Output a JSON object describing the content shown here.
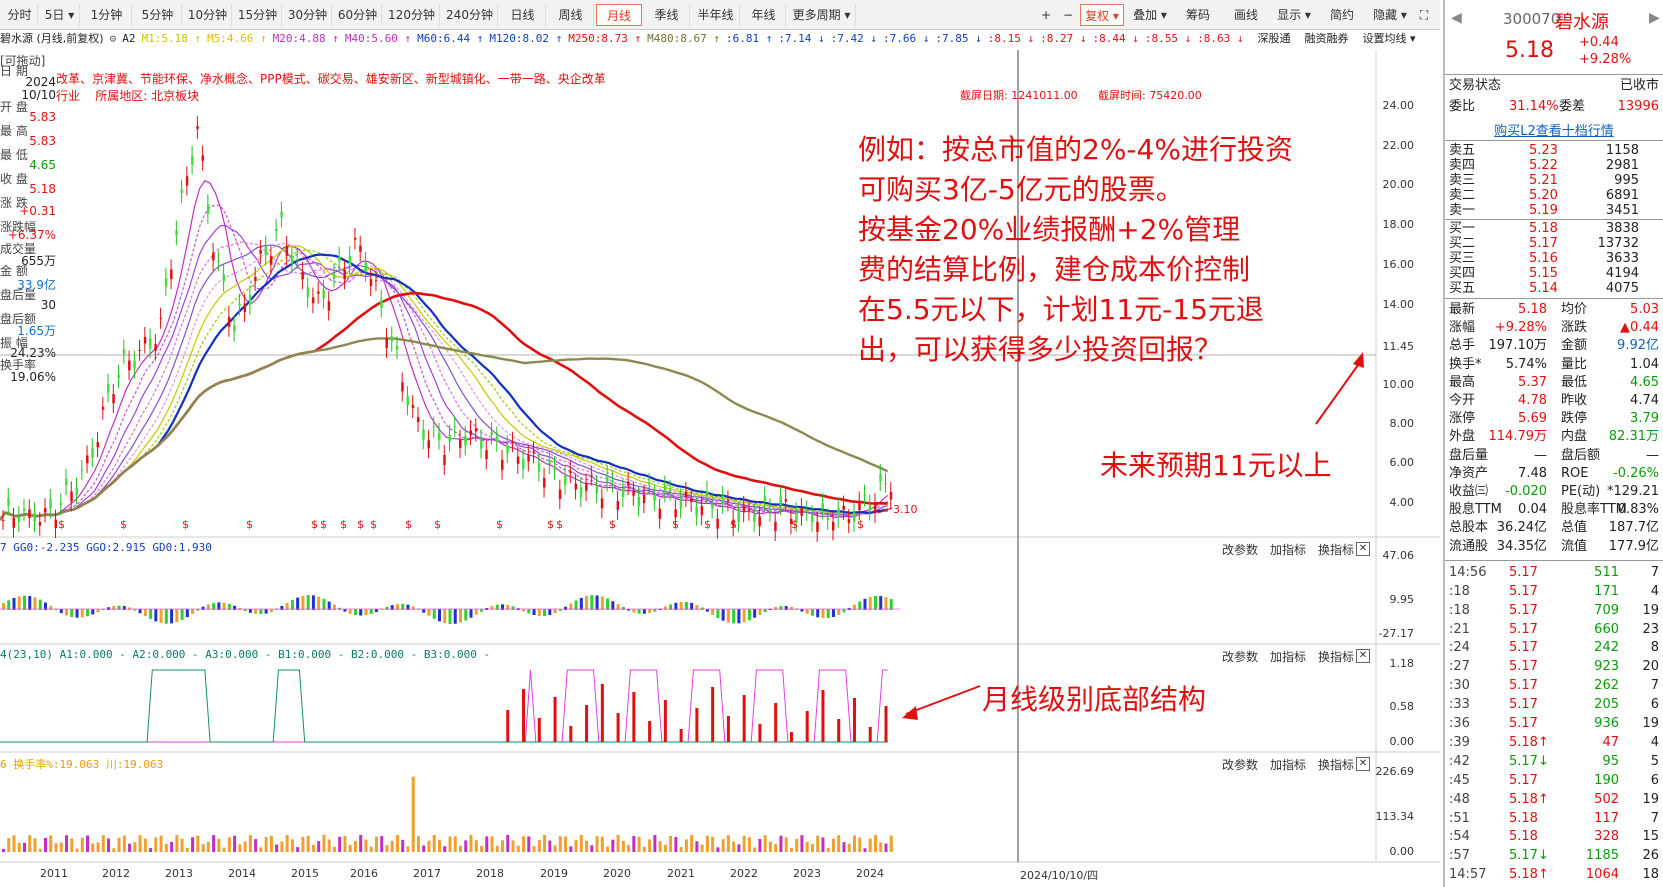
{
  "toolbar": {
    "periods": [
      "分时",
      "5日",
      "1分钟",
      "5分钟",
      "10分钟",
      "15分钟",
      "30分钟",
      "60分钟",
      "120分钟",
      "240分钟",
      "日线",
      "周线",
      "月线",
      "季线",
      "半年线",
      "年线",
      "更多周期"
    ],
    "active": "月线",
    "right_btns": [
      "+",
      "−",
      "复权",
      "叠加",
      "筹码",
      "画线",
      "显示",
      "简约",
      "隐藏"
    ]
  },
  "chart_header": {
    "stock_label": "碧水源 (月线,前复权)",
    "flags": "A2",
    "ma": [
      "M1:5.18",
      "M5:4.66",
      "M20:4.88",
      "M40:5.60",
      "M60:6.44",
      "M120:8.02",
      "M250:8.73",
      "M480:8.67",
      ":6.81",
      ":7.14",
      ":7.42",
      ":7.66",
      ":7.85",
      ":8.15",
      ":8.27",
      ":8.44",
      ":8.55",
      ":8.63"
    ],
    "links": [
      "深股通",
      "融资融券",
      "设置均线"
    ]
  },
  "concepts": "改革、京津冀、节能环保、净水概念、PPP模式、碳交易、雄安新区、新型城镇化、一带一路、央企改革",
  "industry": "行业",
  "region": "所属地区: 北京板块",
  "screenshot_date": "截屏日期: 1241011.00",
  "screenshot_time": "截屏时间: 75420.00",
  "left_info": {
    "drag": "[可拖动]",
    "labels": [
      "日 期",
      "开 盘",
      "最 高",
      "最 低",
      "收 盘",
      "涨 跌",
      "涨跌幅",
      "成交量",
      "金 额",
      "盘后量",
      "盘后额",
      "振 幅",
      "换手率"
    ],
    "values": [
      "2024",
      "10/10",
      "5.83",
      "5.83",
      "4.65",
      "5.18",
      "+0.31",
      "+6.37%",
      "655万",
      "33.9亿",
      "30",
      "1.65万",
      "24.23%",
      "19.06%"
    ]
  },
  "price_axis": [
    "24.00",
    "22.00",
    "20.00",
    "18.00",
    "16.00",
    "14.00",
    "11.45",
    "10.00",
    "8.00",
    "6.00",
    "4.00"
  ],
  "low_mark": "3.10",
  "x_axis": [
    "2011",
    "2012",
    "2013",
    "2014",
    "2015",
    "2016",
    "2017",
    "2018",
    "2019",
    "2020",
    "2021",
    "2022",
    "2023",
    "2024"
  ],
  "cursor_date": "2024/10/10/四",
  "panel1": {
    "label": "7  GG0:-2.235  GGO:2.915  GD0:1.930",
    "axis": [
      "47.06",
      "9.95",
      "-27.17"
    ]
  },
  "panel2": {
    "label": "4(23,10)  A1:0.000 - A2:0.000 - A3:0.000 - B1:0.000 - B2:0.000 - B3:0.000 -",
    "axis": [
      "1.18",
      "0.58",
      "0.00"
    ]
  },
  "panel3": {
    "label": "6  换手率%:19.063  川:19.063",
    "axis": [
      "226.69",
      "113.34",
      "0.00"
    ]
  },
  "panel_btns": [
    "改参数",
    "加指标",
    "换指标"
  ],
  "annotation_main": [
    "例如：按总市值的2%-4%进行投资",
    "可购买3亿-5亿元的股票。",
    "按基金20%业绩报酬+2%管理",
    "费的结算比例，建仓成本价控制",
    "在5.5元以下，计划11元-15元退",
    "出，可以获得多少投资回报？"
  ],
  "annotation_future": "未来预期11元以上",
  "annotation_bottom": "月线级别底部结构",
  "quote": {
    "code": "300070",
    "name": "碧水源",
    "price": "5.18",
    "change": "+0.44",
    "pct": "+9.28%",
    "status_label": "交易状态",
    "status": "已收市",
    "wb_label": "委比",
    "wb": "31.14%",
    "wc_label": "委差",
    "wc": "13996",
    "l2": "购买L2查看十档行情",
    "asks": [
      [
        "卖五",
        "5.23",
        "1158"
      ],
      [
        "卖四",
        "5.22",
        "2981"
      ],
      [
        "卖三",
        "5.21",
        "995"
      ],
      [
        "卖二",
        "5.20",
        "6891"
      ],
      [
        "卖一",
        "5.19",
        "3451"
      ]
    ],
    "bids": [
      [
        "买一",
        "5.18",
        "3838"
      ],
      [
        "买二",
        "5.17",
        "13732"
      ],
      [
        "买三",
        "5.16",
        "3633"
      ],
      [
        "买四",
        "5.15",
        "4194"
      ],
      [
        "买五",
        "5.14",
        "4075"
      ]
    ],
    "stats": [
      [
        "最新",
        "5.18",
        "均价",
        "5.03"
      ],
      [
        "涨幅",
        "+9.28%",
        "涨跌",
        "▲0.44"
      ],
      [
        "总手",
        "197.10万",
        "金额",
        "9.92亿"
      ],
      [
        "换手*",
        "5.74%",
        "量比",
        "1.04"
      ],
      [
        "最高",
        "5.37",
        "最低",
        "4.65"
      ],
      [
        "今开",
        "4.78",
        "昨收",
        "4.74"
      ],
      [
        "涨停",
        "5.69",
        "跌停",
        "3.79"
      ],
      [
        "外盘",
        "114.79万",
        "内盘",
        "82.31万"
      ],
      [
        "盘后量",
        "—",
        "盘后额",
        "—"
      ],
      [
        "净资产",
        "7.48",
        "ROE",
        "-0.26%"
      ],
      [
        "收益㈢",
        "-0.020",
        "PE(动)",
        "*129.21"
      ],
      [
        "股息TTM",
        "0.04",
        "股息率TTM",
        "0.83%"
      ],
      [
        "总股本",
        "36.24亿",
        "总值",
        "187.7亿"
      ],
      [
        "流通股",
        "34.35亿",
        "流值",
        "177.9亿"
      ]
    ],
    "ticks": [
      [
        "14:56",
        "5.17",
        "511",
        "7"
      ],
      [
        ":18",
        "5.17",
        "171",
        "4"
      ],
      [
        ":18",
        "5.17",
        "709",
        "19"
      ],
      [
        ":21",
        "5.17",
        "660",
        "23"
      ],
      [
        ":24",
        "5.17",
        "242",
        "8"
      ],
      [
        ":27",
        "5.17",
        "923",
        "20"
      ],
      [
        ":30",
        "5.17",
        "262",
        "7"
      ],
      [
        ":33",
        "5.17",
        "205",
        "6"
      ],
      [
        ":36",
        "5.17",
        "936",
        "19"
      ],
      [
        ":39",
        "5.18↑",
        "47",
        "4"
      ],
      [
        ":42",
        "5.17↓",
        "95",
        "5"
      ],
      [
        ":45",
        "5.17",
        "190",
        "6"
      ],
      [
        ":48",
        "5.18↑",
        "502",
        "19"
      ],
      [
        ":51",
        "5.18",
        "117",
        "7"
      ],
      [
        ":54",
        "5.18",
        "328",
        "15"
      ],
      [
        ":57",
        "5.17↓",
        "1185",
        "26"
      ],
      [
        "14:57",
        "5.18↑",
        "1064",
        "18"
      ]
    ]
  }
}
